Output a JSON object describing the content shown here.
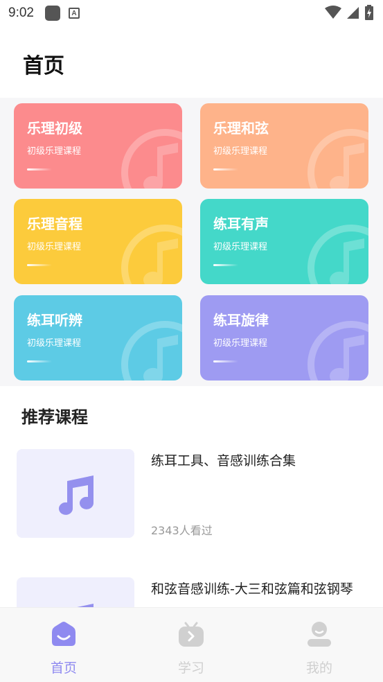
{
  "status_bar": {
    "time": "9:02",
    "icons": [
      "app-square-icon",
      "keyboard-a-icon",
      "wifi-icon",
      "signal-icon",
      "battery-charging-icon"
    ]
  },
  "header": {
    "title": "首页"
  },
  "category_cards": [
    {
      "title": "乐理初级",
      "subtitle": "初级乐理课程",
      "color": "#fc8b8d"
    },
    {
      "title": "乐理和弦",
      "subtitle": "初级乐理课程",
      "color": "#feb38a"
    },
    {
      "title": "乐理音程",
      "subtitle": "初级乐理课程",
      "color": "#fccb3c"
    },
    {
      "title": "练耳有声",
      "subtitle": "初级乐理课程",
      "color": "#44d8c9"
    },
    {
      "title": "练耳听辨",
      "subtitle": "初级乐理课程",
      "color": "#5dcbe5"
    },
    {
      "title": "练耳旋律",
      "subtitle": "初级乐理课程",
      "color": "#9e9bf2"
    }
  ],
  "recommend": {
    "section_title": "推荐课程",
    "courses": [
      {
        "title": "练耳工具、音感训练合集",
        "views": "2343人看过",
        "icon": "music-note-icon"
      },
      {
        "title": "和弦音感训练-大三和弦篇和弦钢琴",
        "views": "",
        "icon": "music-note-icon"
      }
    ]
  },
  "tab_bar": {
    "tabs": [
      {
        "label": "首页",
        "icon": "home-smile-icon",
        "active": true
      },
      {
        "label": "学习",
        "icon": "study-tv-icon",
        "active": false
      },
      {
        "label": "我的",
        "icon": "profile-icon",
        "active": false
      }
    ],
    "active_color": "#8f8af0",
    "inactive_color": "#d0d0d0"
  }
}
